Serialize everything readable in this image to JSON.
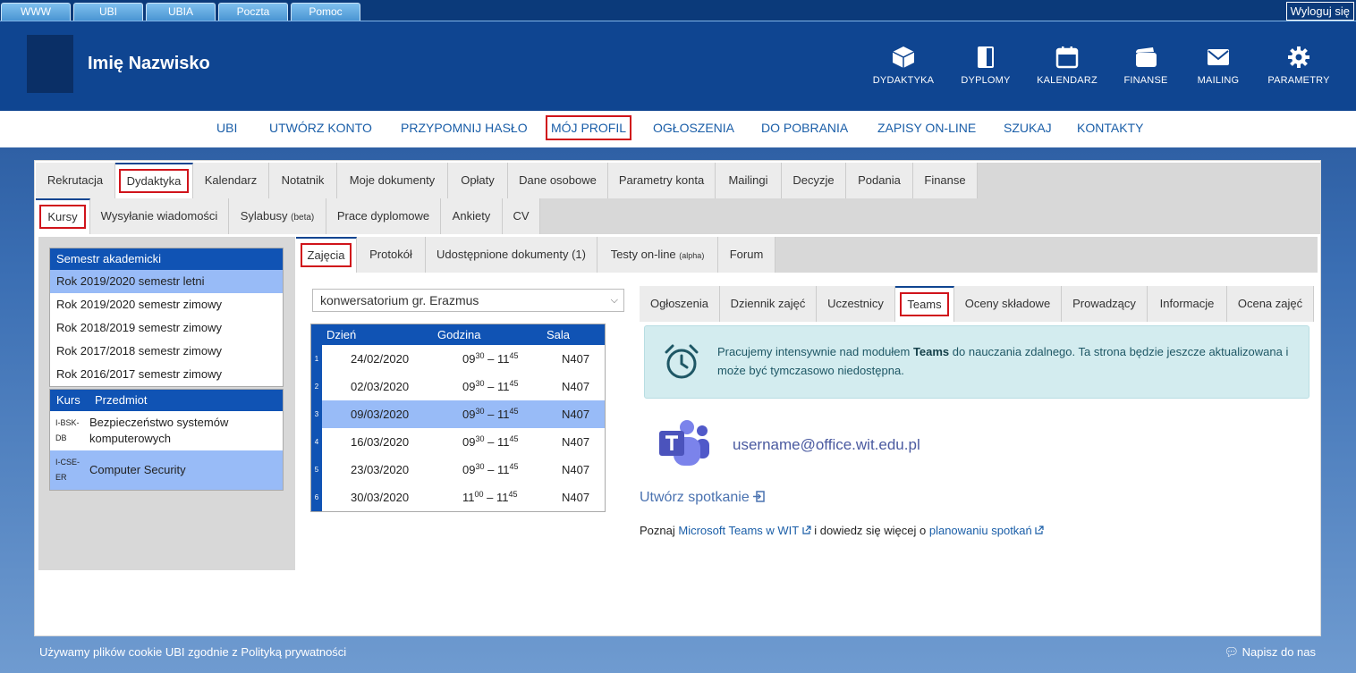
{
  "topbar": {
    "tabs": [
      "WWW",
      "UBI",
      "UBIA",
      "Poczta",
      "Pomoc"
    ],
    "logout": "Wyloguj się"
  },
  "header": {
    "username": "Imię Nazwisko",
    "icons": [
      {
        "label": "DYDAKTYKA",
        "icon": "box-icon"
      },
      {
        "label": "DYPLOMY",
        "icon": "diploma-icon"
      },
      {
        "label": "KALENDARZ",
        "icon": "calendar-icon"
      },
      {
        "label": "FINANSE",
        "icon": "wallet-icon"
      },
      {
        "label": "MAILING",
        "icon": "mail-icon"
      },
      {
        "label": "PARAMETRY",
        "icon": "gear-icon"
      }
    ]
  },
  "mainnav": [
    "UBI",
    "UTWÓRZ KONTO",
    "PRZYPOMNIJ HASŁO",
    "MÓJ PROFIL",
    "OGŁOSZENIA",
    "DO POBRANIA",
    "ZAPISY ON-LINE",
    "SZUKAJ",
    "KONTAKTY"
  ],
  "tabs1": [
    "Rekrutacja",
    "Dydaktyka",
    "Kalendarz",
    "Notatnik",
    "Moje dokumenty",
    "Opłaty",
    "Dane osobowe",
    "Parametry konta",
    "Mailingi",
    "Decyzje",
    "Podania",
    "Finanse"
  ],
  "tabs2": {
    "kursy": "Kursy",
    "wysylanie": "Wysyłanie wiadomości",
    "sylabusy": "Sylabusy",
    "sylabusy_tag": "(beta)",
    "prace": "Prace dyplomowe",
    "ankiety": "Ankiety",
    "cv": "CV"
  },
  "semesters": {
    "header": "Semestr akademicki",
    "items": [
      "Rok 2019/2020 semestr letni",
      "Rok 2019/2020 semestr zimowy",
      "Rok 2018/2019 semestr zimowy",
      "Rok 2017/2018 semestr zimowy",
      "Rok 2016/2017 semestr zimowy"
    ]
  },
  "courses": {
    "col_kurs": "Kurs",
    "col_przedmiot": "Przedmiot",
    "items": [
      {
        "code": "I-BSK-DB",
        "name": "Bezpieczeństwo systemów komputerowych"
      },
      {
        "code": "I-CSE-ER",
        "name": "Computer Security"
      }
    ]
  },
  "tabs3": {
    "zajecia": "Zajęcia",
    "protokol": "Protokół",
    "dokumenty": "Udostępnione dokumenty (1)",
    "testy": "Testy on-line",
    "testy_tag": "(alpha)",
    "forum": "Forum"
  },
  "group_select": "konwersatorium gr. Erazmus",
  "schedule": {
    "headers": {
      "day": "Dzień",
      "hour": "Godzina",
      "room": "Sala"
    },
    "rows": [
      {
        "n": "1",
        "date": "24/02/2020",
        "start_h": "09",
        "start_m": "30",
        "end_h": "11",
        "end_m": "45",
        "room": "N407"
      },
      {
        "n": "2",
        "date": "02/03/2020",
        "start_h": "09",
        "start_m": "30",
        "end_h": "11",
        "end_m": "45",
        "room": "N407"
      },
      {
        "n": "3",
        "date": "09/03/2020",
        "start_h": "09",
        "start_m": "30",
        "end_h": "11",
        "end_m": "45",
        "room": "N407"
      },
      {
        "n": "4",
        "date": "16/03/2020",
        "start_h": "09",
        "start_m": "30",
        "end_h": "11",
        "end_m": "45",
        "room": "N407"
      },
      {
        "n": "5",
        "date": "23/03/2020",
        "start_h": "09",
        "start_m": "30",
        "end_h": "11",
        "end_m": "45",
        "room": "N407"
      },
      {
        "n": "6",
        "date": "30/03/2020",
        "start_h": "11",
        "start_m": "00",
        "end_h": "11",
        "end_m": "45",
        "room": "N407"
      }
    ]
  },
  "rtabs": [
    "Ogłoszenia",
    "Dziennik zajęć",
    "Uczestnicy",
    "Teams",
    "Oceny składowe",
    "Prowadzący",
    "Informacje",
    "Ocena zajęć"
  ],
  "info": {
    "pre": "Pracujemy intensywnie nad modułem ",
    "bold": "Teams",
    "post": " do nauczania zdalnego. Ta strona będzie jeszcze aktualizowana i może być tymczasowo niedostępna."
  },
  "teams": {
    "email": "username@office.wit.edu.pl",
    "create_meeting": "Utwórz spotkanie",
    "learn_pre": "Poznaj ",
    "learn_link1": "Microsoft Teams w WIT",
    "learn_mid": " i dowiedz się więcej o ",
    "learn_link2": "planowaniu spotkań"
  },
  "footer": {
    "cookie": "Używamy plików cookie UBI zgodnie z Polityką prywatności",
    "chat": "Napisz do nas"
  },
  "colors": {
    "header": "#0f4591",
    "accent_red": "#d0141b",
    "selected": "#98bbf7",
    "link": "#1a5ea8"
  }
}
